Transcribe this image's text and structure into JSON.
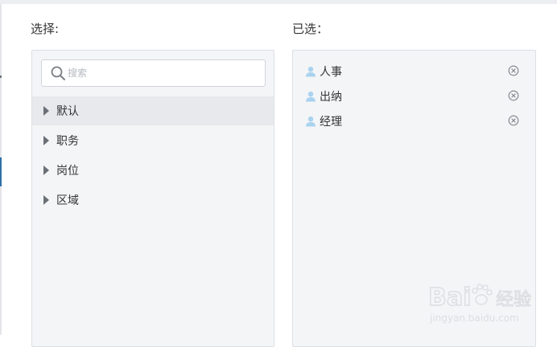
{
  "dialog": {
    "left_title": "选择:",
    "right_title": "已选："
  },
  "search": {
    "placeholder": "搜索",
    "value": "",
    "icon": "search-icon"
  },
  "tree": {
    "items": [
      {
        "label": "默认",
        "active": true
      },
      {
        "label": "职务",
        "active": false
      },
      {
        "label": "岗位",
        "active": false
      },
      {
        "label": "区域",
        "active": false
      }
    ]
  },
  "selected": {
    "items": [
      {
        "label": "人事",
        "icon": "user-icon"
      },
      {
        "label": "出纳",
        "icon": "user-icon"
      },
      {
        "label": "经理",
        "icon": "user-icon"
      }
    ]
  },
  "watermark": {
    "brand": "Bai",
    "brand_cn": "经验",
    "url": "jingyan.baidu.com"
  },
  "colors": {
    "panel_bg": "#f4f5f7",
    "active_row": "#e7e9ed",
    "user_icon": "#a9d3ef",
    "text": "#333333"
  }
}
